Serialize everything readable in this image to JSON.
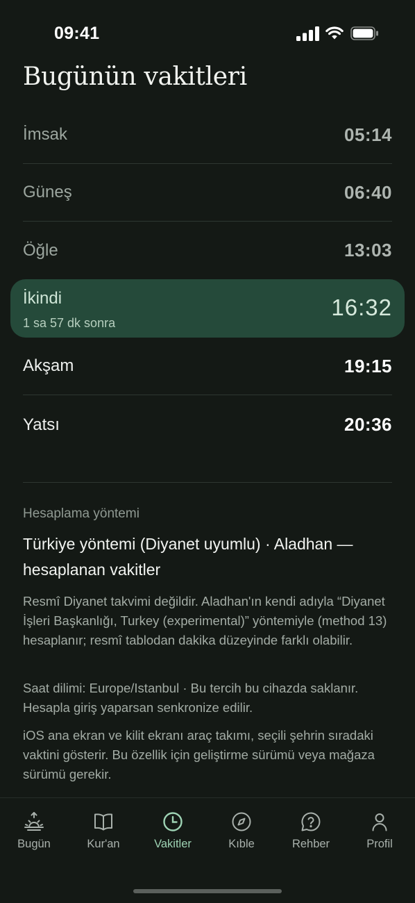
{
  "status_bar": {
    "time": "09:41"
  },
  "page": {
    "title": "Bugünün vakitleri"
  },
  "prayers": [
    {
      "name": "İmsak",
      "time": "05:14"
    },
    {
      "name": "Güneş",
      "time": "06:40"
    },
    {
      "name": "Öğle",
      "time": "13:03"
    },
    {
      "name": "İkindi",
      "time": "16:32",
      "countdown": "1 sa 57 dk sonra"
    },
    {
      "name": "Akşam",
      "time": "19:15"
    },
    {
      "name": "Yatsı",
      "time": "20:36"
    }
  ],
  "method": {
    "caption": "Hesaplama yöntemi",
    "title": "Türkiye yöntemi (Diyanet uyumlu) · Aladhan — hesaplanan vakitler",
    "paragraphs": [
      "Resmî Diyanet takvimi değildir. Aladhan'ın kendi adıyla “Diyanet İşleri Başkanlığı, Turkey (experimental)” yöntemiyle (method 13) hesaplanır; resmî tablodan dakika düzeyinde farklı olabilir.",
      "Saat dilimi: Europe/Istanbul · Bu tercih bu cihazda saklanır. Hesapla giriş yaparsan senkronize edilir.",
      "iOS ana ekran ve kilit ekranı araç takımı, seçili şehrin sıradaki vaktini gösterir. Bu özellik için geliştirme sürümü veya mağaza sürümü gerekir."
    ]
  },
  "tabs": [
    {
      "label": "Bugün",
      "icon": "sunrise-icon"
    },
    {
      "label": "Kur'an",
      "icon": "book-icon"
    },
    {
      "label": "Vakitler",
      "icon": "clock-icon",
      "active": true
    },
    {
      "label": "Kıble",
      "icon": "compass-icon"
    },
    {
      "label": "Rehber",
      "icon": "help-circle-icon"
    },
    {
      "label": "Profil",
      "icon": "user-icon"
    }
  ],
  "colors": {
    "background": "#141915",
    "highlight_row": "#254a3a",
    "active_tab": "#9ed3b4",
    "text_primary": "#f1f3ef",
    "text_muted": "#9ca69f"
  }
}
